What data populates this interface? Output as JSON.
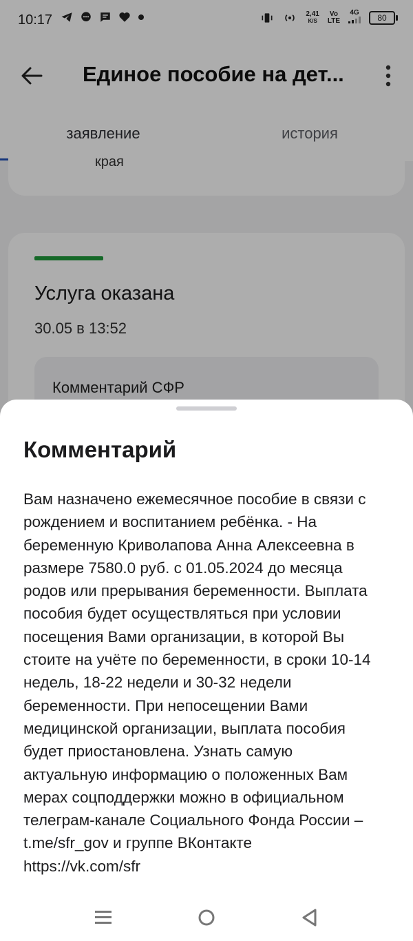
{
  "status_bar": {
    "time": "10:17",
    "left_icons": [
      "telegram-icon",
      "chat-bubble-icon",
      "message-icon",
      "heart-icon",
      "dot-icon"
    ],
    "speed_value": "2,41",
    "speed_unit": "K/S",
    "volte_top": "Vo",
    "volte_bottom": "LTE",
    "network": "4G",
    "battery": "80"
  },
  "app_bar": {
    "title": "Единое пособие на дет..."
  },
  "tabs": [
    {
      "label": "заявление",
      "active": true
    },
    {
      "label": "история",
      "active": false
    }
  ],
  "previous_card": {
    "text": "края"
  },
  "status_card": {
    "accent_color": "#1f9a3b",
    "title": "Услуга оказана",
    "date": "30.05 в 13:52",
    "comment_label": "Комментарий СФР"
  },
  "sheet": {
    "title": "Комментарий",
    "body": "Вам назначено ежемесячное пособие в связи с\nрождением и воспитанием ребёнка. - На\nбеременную Криволапова Анна Алексеевна в\nразмере 7580.0 руб. с 01.05.2024 до месяца\nродов или прерывания беременности. Выплата\nпособия будет осуществляться при условии\nпосещения Вами организации, в которой Вы\nстоите на учёте по беременности, в сроки 10-14\nнедель, 18-22 недели и 30-32 недели\nбеременности. При непосещении Вами\nмедицинской организации, выплата пособия\nбудет приостановлена. Узнать самую\nактуальную информацию о положенных Вам\nмерах соцподдержки можно в официальном\nтелеграм-канале Социального Фонда России –\nt.me/sfr_gov и группе ВКонтакте\nhttps://vk.com/sfr"
  },
  "nav_bar": {
    "buttons": [
      "menu-icon",
      "home-icon",
      "back-triangle-icon"
    ]
  }
}
